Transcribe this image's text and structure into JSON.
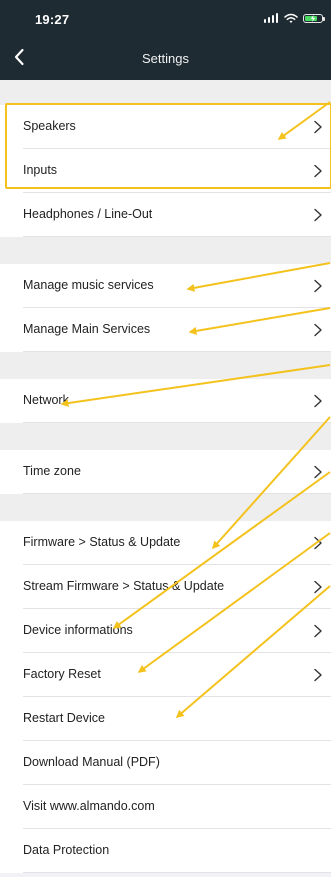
{
  "status_bar": {
    "time": "19:27",
    "signal_icon": "signal-icon",
    "wifi_icon": "wifi-icon",
    "battery_icon": "battery-charging-icon"
  },
  "header": {
    "title": "Settings",
    "back_icon": "chevron-left-icon"
  },
  "settings": {
    "items": [
      {
        "label": "Speakers"
      },
      {
        "label": "Inputs"
      },
      {
        "label": "Headphones / Line-Out"
      },
      {
        "label": "Manage music services"
      },
      {
        "label": "Manage Main Services"
      },
      {
        "label": "Network"
      },
      {
        "label": "Time zone"
      },
      {
        "label": "Firmware > Status & Update"
      },
      {
        "label": "Stream Firmware > Status & Update"
      },
      {
        "label": "Device informations"
      },
      {
        "label": "Factory Reset"
      },
      {
        "label": "Restart Device"
      },
      {
        "label": "Download Manual (PDF)"
      },
      {
        "label": "Visit www.almando.com"
      },
      {
        "label": "Data Protection"
      }
    ]
  },
  "colors": {
    "header_background": "#1e2b33",
    "page_background": "#f2f2f6",
    "row_background": "#ffffff",
    "annotation_yellow": "#f4c21d"
  }
}
